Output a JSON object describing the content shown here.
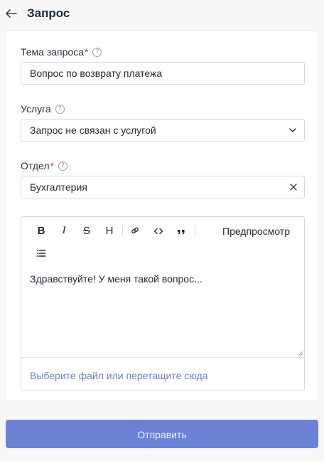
{
  "header": {
    "title": "Запрос",
    "back_icon": "arrow-left-icon"
  },
  "form": {
    "subject": {
      "label": "Тема запроса",
      "required_mark": "*",
      "help": "?",
      "value": "Вопрос по возврату платежа"
    },
    "service": {
      "label": "Услуга",
      "help": "?",
      "value": "Запрос не связан с услугой"
    },
    "department": {
      "label": "Отдел",
      "required_mark": "*",
      "help": "?",
      "value": "Бухгалтерия"
    },
    "editor": {
      "toolbar": {
        "bold": "B",
        "italic": "I",
        "strike": "S",
        "heading": "H",
        "preview_label": "Предпросмотр"
      },
      "text": "Здравствуйте! У меня такой вопрос...",
      "attach_label": "Выберите файл или перетащите сюда"
    }
  },
  "submit_label": "Отправить",
  "colors": {
    "accent": "#6c82d6",
    "link": "#6a7fcf",
    "required": "#d72f45"
  }
}
